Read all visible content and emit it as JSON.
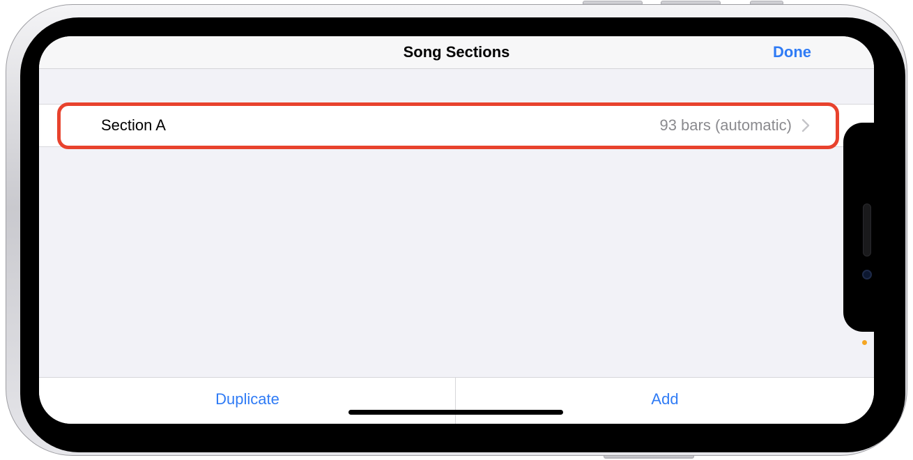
{
  "nav": {
    "title": "Song Sections",
    "done_label": "Done"
  },
  "sections": [
    {
      "title": "Section A",
      "detail": "93 bars (automatic)",
      "accessory": "chevron-right-icon"
    }
  ],
  "toolbar": {
    "duplicate_label": "Duplicate",
    "add_label": "Add"
  },
  "colors": {
    "accent": "#2f7bf5",
    "highlight": "#e8422d",
    "background": "#f2f2f7",
    "detail_text": "#8a8a8e",
    "indicator_dot": "#f5a623"
  }
}
